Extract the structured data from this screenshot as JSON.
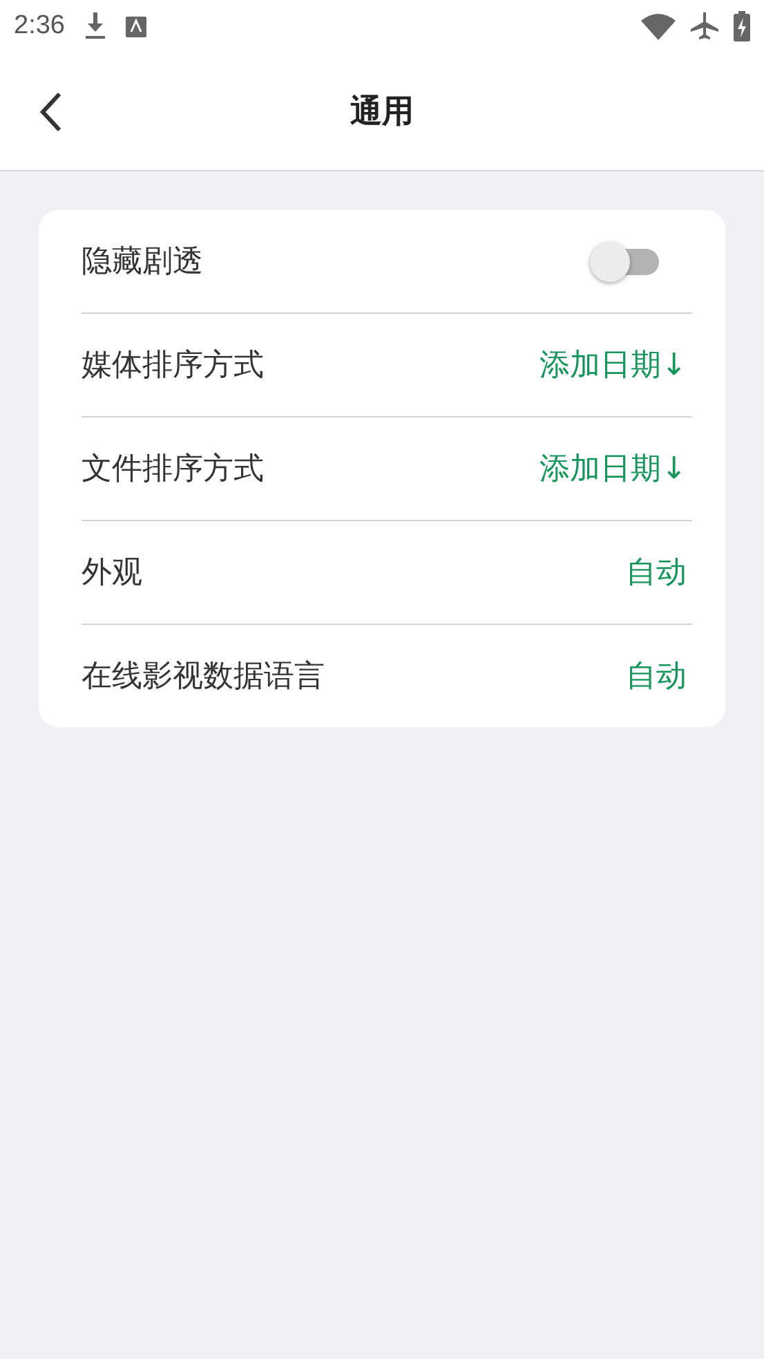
{
  "status_bar": {
    "time": "2:36"
  },
  "header": {
    "title": "通用"
  },
  "settings": [
    {
      "label": "隐藏剧透",
      "kind": "toggle",
      "on": false
    },
    {
      "label": "媒体排序方式",
      "kind": "value",
      "value": "添加日期↓"
    },
    {
      "label": "文件排序方式",
      "kind": "value",
      "value": "添加日期↓"
    },
    {
      "label": "外观",
      "kind": "value",
      "value": "自动"
    },
    {
      "label": "在线影视数据语言",
      "kind": "value",
      "value": "自动"
    }
  ]
}
